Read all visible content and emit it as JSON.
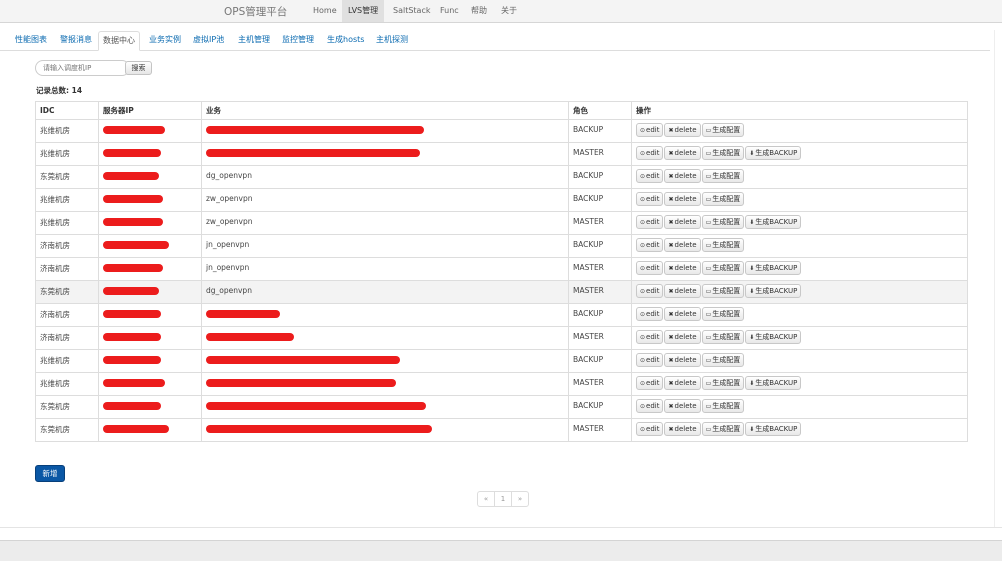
{
  "nav": {
    "brand": "OPS管理平台",
    "items": [
      "Home",
      "LVS管理",
      "SaltStack",
      "Func",
      "帮助",
      "关于"
    ],
    "active_index": 1
  },
  "tabs": {
    "items": [
      "性能图表",
      "警报消息",
      "数据中心",
      "业务实例",
      "虚拟IP池",
      "主机管理",
      "监控管理",
      "生成hosts",
      "主机探测"
    ],
    "active_index": 2
  },
  "search": {
    "placeholder": "请输入调度机IP",
    "button": "搜索"
  },
  "summary": {
    "record_count_label": "记录总数: 14"
  },
  "table": {
    "headers": [
      "IDC",
      "服务器IP",
      "业务",
      "角色",
      "操作"
    ],
    "rows": [
      {
        "idc": "兆维机房",
        "business": "",
        "role": "BACKUP",
        "gen_backup": false
      },
      {
        "idc": "兆维机房",
        "business": "",
        "role": "MASTER",
        "gen_backup": true
      },
      {
        "idc": "东莞机房",
        "business": "dg_openvpn",
        "role": "BACKUP",
        "gen_backup": false
      },
      {
        "idc": "兆维机房",
        "business": "zw_openvpn",
        "role": "BACKUP",
        "gen_backup": false
      },
      {
        "idc": "兆维机房",
        "business": "zw_openvpn",
        "role": "MASTER",
        "gen_backup": true
      },
      {
        "idc": "济南机房",
        "business": "jn_openvpn",
        "role": "BACKUP",
        "gen_backup": false
      },
      {
        "idc": "济南机房",
        "business": "jn_openvpn",
        "role": "MASTER",
        "gen_backup": true
      },
      {
        "idc": "东莞机房",
        "business": "dg_openvpn",
        "role": "MASTER",
        "gen_backup": true
      },
      {
        "idc": "济南机房",
        "business": "",
        "role": "BACKUP",
        "gen_backup": false
      },
      {
        "idc": "济南机房",
        "business": "",
        "role": "MASTER",
        "gen_backup": true
      },
      {
        "idc": "兆维机房",
        "business": "",
        "role": "BACKUP",
        "gen_backup": false
      },
      {
        "idc": "兆维机房",
        "business": "",
        "role": "MASTER",
        "gen_backup": true
      },
      {
        "idc": "东莞机房",
        "business": "",
        "role": "BACKUP",
        "gen_backup": false
      },
      {
        "idc": "东莞机房",
        "business": "",
        "role": "MASTER",
        "gen_backup": true
      }
    ],
    "highlighted_row": 7,
    "actions": {
      "edit": "edit",
      "delete": "delete",
      "gen_config": "生成配置",
      "gen_backup": "生成BACKUP"
    },
    "icons": {
      "edit": "edit-icon",
      "delete": "close-icon",
      "gen_config": "folder-open-icon",
      "gen_backup": "download-arrow-icon"
    }
  },
  "add_button": "新增",
  "pager": {
    "prev": "«",
    "current": "1",
    "next": "»"
  },
  "colors": {
    "link": "#0a6ab0",
    "primary_button": "#0a57a5",
    "redaction": "#ec1c1c",
    "row_highlight": "#f3f3f3"
  }
}
